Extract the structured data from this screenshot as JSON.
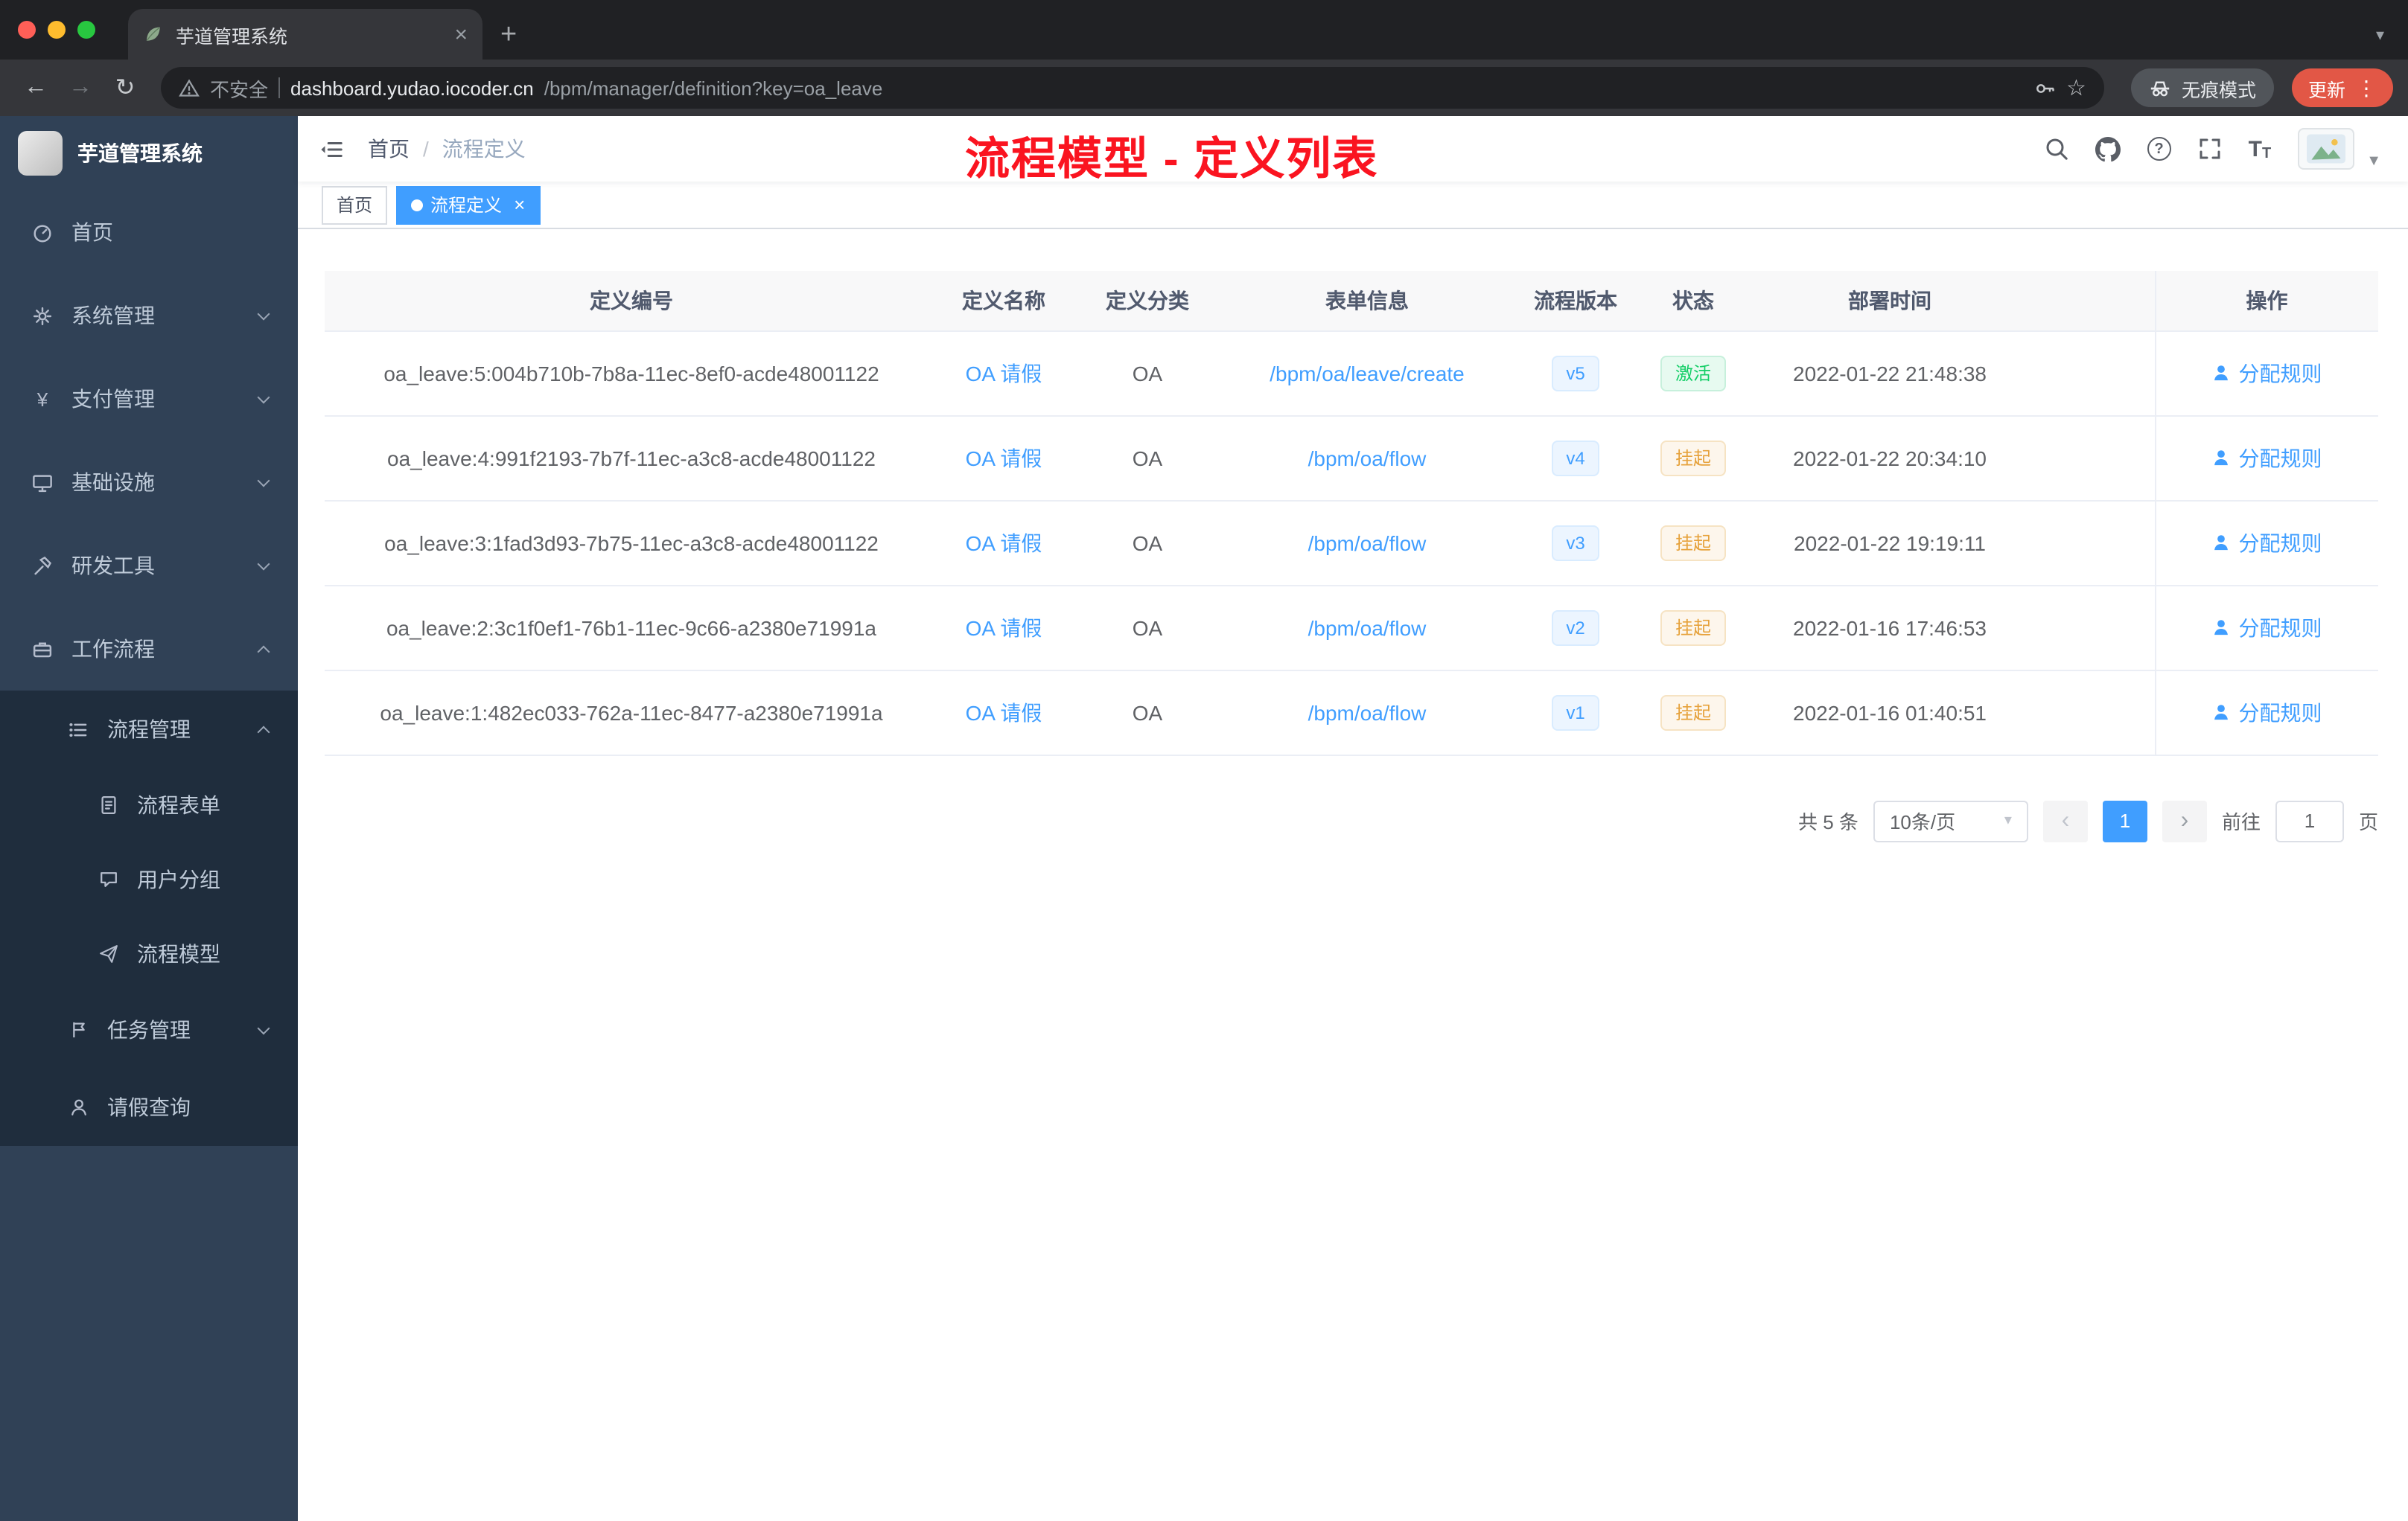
{
  "browser": {
    "tab_title": "芋道管理系统",
    "security_label": "不安全",
    "url_host": "dashboard.yudao.iocoder.cn",
    "url_path": "/bpm/manager/definition?key=oa_leave",
    "incognito_label": "无痕模式",
    "update_label": "更新"
  },
  "sidebar": {
    "logo_title": "芋道管理系统",
    "items": [
      {
        "label": "首页",
        "icon": "dashboard-icon"
      },
      {
        "label": "系统管理",
        "icon": "gear-icon"
      },
      {
        "label": "支付管理",
        "icon": "yen-icon"
      },
      {
        "label": "基础设施",
        "icon": "monitor-icon"
      },
      {
        "label": "研发工具",
        "icon": "tools-icon"
      },
      {
        "label": "工作流程",
        "icon": "briefcase-icon"
      },
      {
        "label": "流程管理",
        "icon": "list-icon"
      },
      {
        "label": "流程表单",
        "icon": "form-icon"
      },
      {
        "label": "用户分组",
        "icon": "chat-icon"
      },
      {
        "label": "流程模型",
        "icon": "send-icon"
      },
      {
        "label": "任务管理",
        "icon": "flag-icon"
      },
      {
        "label": "请假查询",
        "icon": "user-icon"
      }
    ]
  },
  "header": {
    "breadcrumb": [
      "首页",
      "流程定义"
    ],
    "annotation": "流程模型 - 定义列表",
    "navbar_icons": [
      "search-icon",
      "github-icon",
      "question-icon",
      "fullscreen-icon",
      "font-size-icon",
      "avatar",
      "caret-down-icon"
    ]
  },
  "tags": {
    "items": [
      {
        "label": "首页",
        "active": false
      },
      {
        "label": "流程定义",
        "active": true
      }
    ]
  },
  "table": {
    "columns": [
      "定义编号",
      "定义名称",
      "定义分类",
      "表单信息",
      "流程版本",
      "状态",
      "部署时间",
      "操作"
    ],
    "rows": [
      {
        "id": "oa_leave:5:004b710b-7b8a-11ec-8ef0-acde48001122",
        "name": "OA 请假",
        "category": "OA",
        "form": "/bpm/oa/leave/create",
        "version": "v5",
        "status": "激活",
        "status_type": "success",
        "time": "2022-01-22 21:48:38",
        "action": "分配规则"
      },
      {
        "id": "oa_leave:4:991f2193-7b7f-11ec-a3c8-acde48001122",
        "name": "OA 请假",
        "category": "OA",
        "form": "/bpm/oa/flow",
        "version": "v4",
        "status": "挂起",
        "status_type": "warning",
        "time": "2022-01-22 20:34:10",
        "action": "分配规则"
      },
      {
        "id": "oa_leave:3:1fad3d93-7b75-11ec-a3c8-acde48001122",
        "name": "OA 请假",
        "category": "OA",
        "form": "/bpm/oa/flow",
        "version": "v3",
        "status": "挂起",
        "status_type": "warning",
        "time": "2022-01-22 19:19:11",
        "action": "分配规则"
      },
      {
        "id": "oa_leave:2:3c1f0ef1-76b1-11ec-9c66-a2380e71991a",
        "name": "OA 请假",
        "category": "OA",
        "form": "/bpm/oa/flow",
        "version": "v2",
        "status": "挂起",
        "status_type": "warning",
        "time": "2022-01-16 17:46:53",
        "action": "分配规则"
      },
      {
        "id": "oa_leave:1:482ec033-762a-11ec-8477-a2380e71991a",
        "name": "OA 请假",
        "category": "OA",
        "form": "/bpm/oa/flow",
        "version": "v1",
        "status": "挂起",
        "status_type": "warning",
        "time": "2022-01-16 01:40:51",
        "action": "分配规则"
      }
    ]
  },
  "pagination": {
    "total_label": "共 5 条",
    "page_size_label": "10条/页",
    "current_page": "1",
    "goto_label": "前往",
    "goto_value": "1",
    "page_unit": "页"
  },
  "colors": {
    "accent": "#409eff",
    "success": "#13ce66",
    "warning": "#e6a23c",
    "sidebar_bg": "#304156",
    "sidebar_submenu_bg": "#1f2d3d",
    "annotation_red": "#fa1420"
  }
}
